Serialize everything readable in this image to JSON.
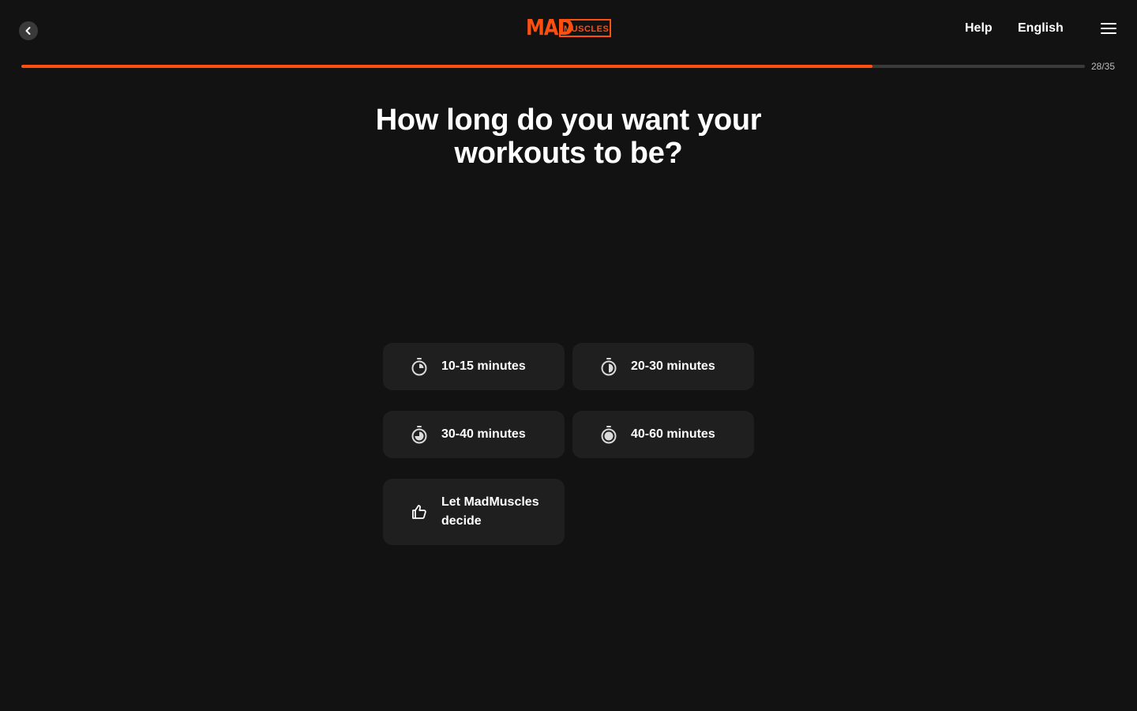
{
  "header": {
    "logo_primary": "MAD",
    "logo_secondary": "MUSCLES",
    "help_label": "Help",
    "language_label": "English"
  },
  "progress": {
    "current": 28,
    "total": 35,
    "label": "28/35"
  },
  "question": {
    "title": "How long do you want your workouts to be?"
  },
  "options": [
    {
      "label": "10-15 minutes",
      "icon": "stopwatch-quarter-icon"
    },
    {
      "label": "20-30 minutes",
      "icon": "stopwatch-half-icon"
    },
    {
      "label": "30-40 minutes",
      "icon": "stopwatch-three-quarter-icon"
    },
    {
      "label": "40-60 minutes",
      "icon": "stopwatch-full-icon"
    },
    {
      "label": "Let MadMuscles decide",
      "icon": "thumbs-up-icon"
    }
  ],
  "colors": {
    "background": "#121212",
    "accent": "#ff4f0f",
    "card": "#1f1f1f",
    "track": "#3a3a3a",
    "text": "#ffffff"
  }
}
